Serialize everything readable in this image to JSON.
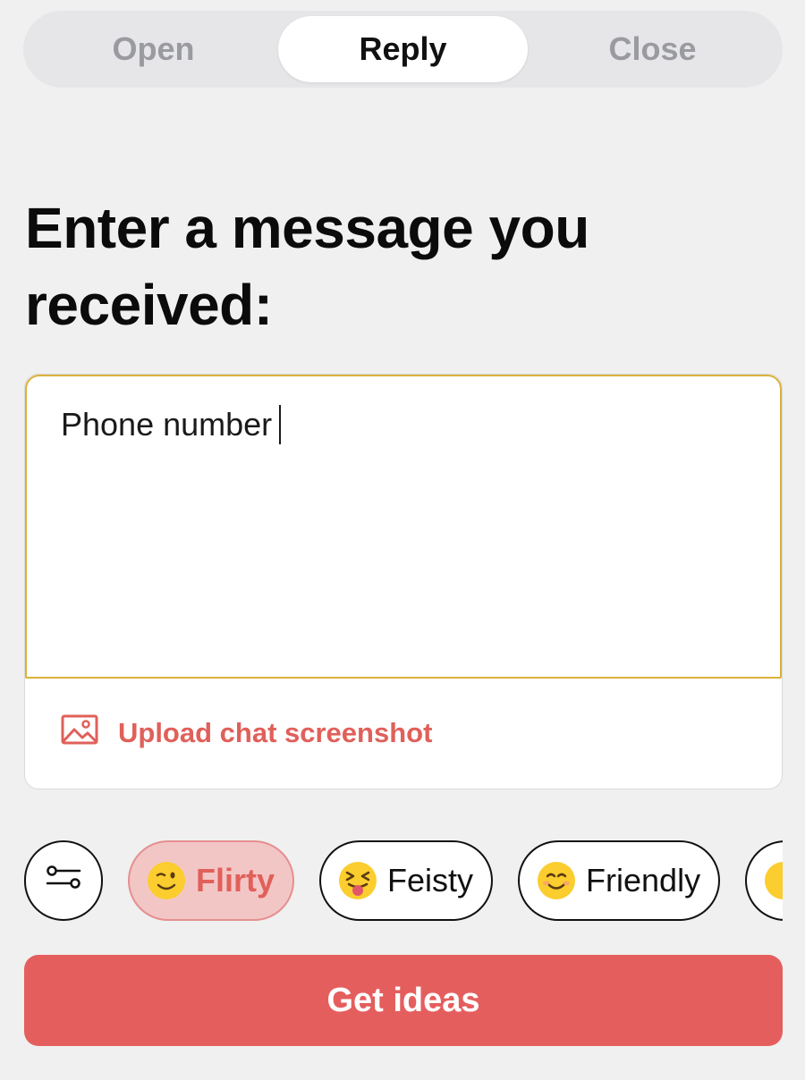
{
  "tabs": [
    {
      "label": "Open",
      "active": false
    },
    {
      "label": "Reply",
      "active": true
    },
    {
      "label": "Close",
      "active": false
    }
  ],
  "heading": "Enter a message you received:",
  "message_input": {
    "value": "Phone number"
  },
  "upload": {
    "label": "Upload chat screenshot",
    "icon": "image-icon"
  },
  "chips": {
    "settings_icon": "sliders-icon",
    "items": [
      {
        "label": "Flirty",
        "emoji": "winking-face",
        "selected": true
      },
      {
        "label": "Feisty",
        "emoji": "squinting-face-with-tongue",
        "selected": false
      },
      {
        "label": "Friendly",
        "emoji": "smiling-face",
        "selected": false
      }
    ]
  },
  "cta": {
    "label": "Get ideas"
  },
  "colors": {
    "accent": "#e55e5e",
    "accent_text": "#e0605a",
    "selected_chip_bg": "#f3c6c6",
    "input_focus_border": "#d9b23a",
    "background": "#f0f0f0"
  }
}
